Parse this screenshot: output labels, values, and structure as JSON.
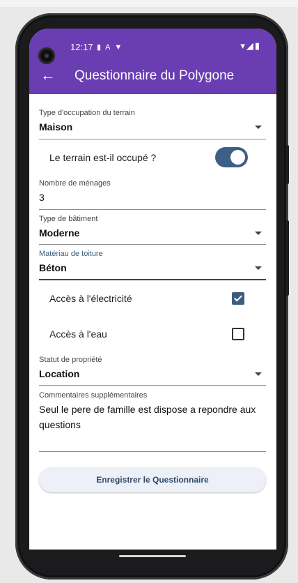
{
  "status_bar": {
    "time": "12:17",
    "left_icons": [
      "sim-card-icon",
      "notification-a-icon",
      "vpn-shield-icon"
    ],
    "right_icons": [
      "wifi-icon",
      "signal-icon",
      "battery-icon"
    ]
  },
  "app_bar": {
    "title": "Questionnaire du Polygone",
    "back_icon": "arrow-back-icon"
  },
  "form": {
    "occupation_type": {
      "label": "Type d'occupation du terrain",
      "value": "Maison"
    },
    "occupied_toggle": {
      "label": "Le terrain est-il occupé ?",
      "on": true
    },
    "households": {
      "label": "Nombre de ménages",
      "value": "3"
    },
    "building_type": {
      "label": "Type de bâtiment",
      "value": "Moderne"
    },
    "roof_material": {
      "label": "Matériau de toiture",
      "value": "Béton"
    },
    "electricity": {
      "label": "Accès à l'électricité",
      "checked": true
    },
    "water": {
      "label": "Accès à l'eau",
      "checked": false
    },
    "ownership": {
      "label": "Statut de propriété",
      "value": "Location"
    },
    "comments": {
      "label": "Commentaires supplémentaires",
      "value": "Seul le pere de famille est dispose a repondre aux questions"
    }
  },
  "submit_label": "Enregistrer le Questionnaire",
  "colors": {
    "app_bar": "#6a3db3",
    "accent": "#3d5f86"
  }
}
